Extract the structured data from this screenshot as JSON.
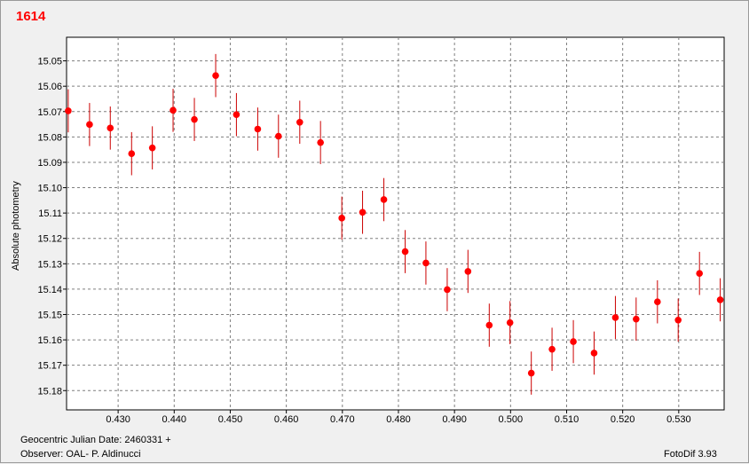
{
  "header": {
    "title": "1614"
  },
  "footer": {
    "julian_date": "Geocentric Julian Date: 2460331 +",
    "observer": "Observer: OAL- P. Aldinucci",
    "software": "FotoDif 3.93"
  },
  "colors": {
    "points": "#ff0000",
    "errorbars": "#cc0000",
    "grid": "#7f7f7f",
    "plot_bg": "#ffffff",
    "window_bg": "#f0f0f0",
    "title": "#ff0000"
  },
  "chart_data": {
    "type": "scatter",
    "ylabel": "Absolute photometry",
    "xlabel": "",
    "xlim": [
      0.4208,
      0.5381
    ],
    "ylim": [
      15.1876,
      15.0407
    ],
    "y_inverted": true,
    "grid": true,
    "xticks": [
      "0.430",
      "0.440",
      "0.450",
      "0.460",
      "0.470",
      "0.480",
      "0.490",
      "0.500",
      "0.510",
      "0.520",
      "0.530"
    ],
    "yticks": [
      "15.05",
      "15.06",
      "15.07",
      "15.08",
      "15.09",
      "15.10",
      "15.11",
      "15.12",
      "15.13",
      "15.14",
      "15.15",
      "15.16",
      "15.17",
      "15.18"
    ],
    "error": 0.0085,
    "series": [
      {
        "x": [
          0.4211,
          0.4249,
          0.4286,
          0.4324,
          0.4361,
          0.4398,
          0.4436,
          0.4474,
          0.4511,
          0.4549,
          0.4586,
          0.4624,
          0.4661,
          0.4699,
          0.4736,
          0.4774,
          0.4812,
          0.4849,
          0.4887,
          0.4924,
          0.4962,
          0.4999,
          0.5037,
          0.5074,
          0.5112,
          0.5149,
          0.5187,
          0.5224,
          0.5262,
          0.5299,
          0.5337,
          0.5374
        ],
        "y": [
          15.0697,
          15.0751,
          15.0765,
          15.0866,
          15.0843,
          15.0695,
          15.0731,
          15.0558,
          15.0712,
          15.0769,
          15.0797,
          15.0742,
          15.0822,
          15.112,
          15.1097,
          15.1047,
          15.1252,
          15.1297,
          15.1402,
          15.133,
          15.1542,
          15.1532,
          15.1731,
          15.1637,
          15.1607,
          15.1652,
          15.1512,
          15.1518,
          15.145,
          15.1522,
          15.1338,
          15.1442
        ]
      }
    ]
  }
}
